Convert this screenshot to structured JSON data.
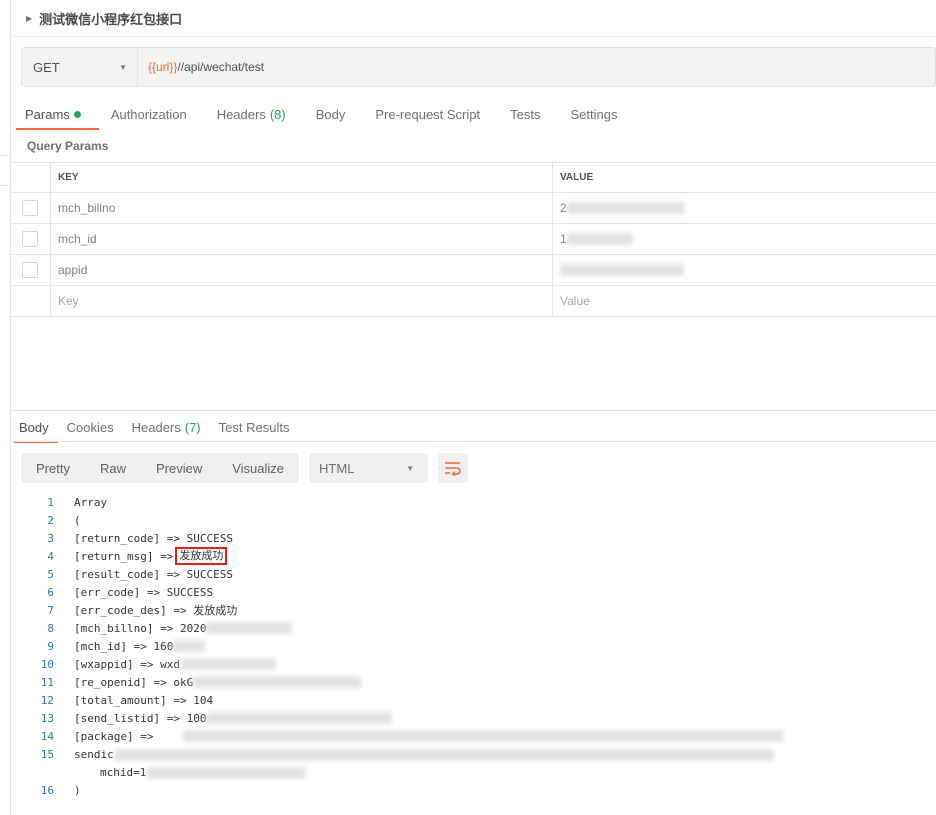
{
  "request": {
    "title": "测试微信小程序红包接口",
    "method": "GET",
    "url_variable": "{{url}}",
    "url_path": "//api/wechat/test"
  },
  "request_tabs": [
    {
      "label": "Params",
      "dot": true
    },
    {
      "label": "Authorization"
    },
    {
      "label": "Headers",
      "count": "(8)"
    },
    {
      "label": "Body"
    },
    {
      "label": "Pre-request Script"
    },
    {
      "label": "Tests"
    },
    {
      "label": "Settings"
    }
  ],
  "query_params": {
    "label": "Query Params",
    "headers": {
      "key": "KEY",
      "value": "VALUE"
    },
    "rows": [
      {
        "key": "mch_billno",
        "value": "2"
      },
      {
        "key": "mch_id",
        "value": "1"
      },
      {
        "key": "appid",
        "value": ""
      }
    ],
    "placeholder": {
      "key": "Key",
      "value": "Value"
    }
  },
  "response_tabs": [
    {
      "label": "Body"
    },
    {
      "label": "Cookies"
    },
    {
      "label": "Headers",
      "count": "(7)"
    },
    {
      "label": "Test Results"
    }
  ],
  "viewer": {
    "modes": [
      "Pretty",
      "Raw",
      "Preview",
      "Visualize"
    ],
    "format": "HTML",
    "wrap_icon": "wrap-lines-icon"
  },
  "code_lines": [
    {
      "n": "1",
      "text": "Array"
    },
    {
      "n": "2",
      "text": "("
    },
    {
      "n": "3",
      "text": "[return_code] => SUCCESS"
    },
    {
      "n": "4",
      "text": "[return_msg] =>",
      "highlight": "发放成功"
    },
    {
      "n": "5",
      "text": "[result_code] => SUCCESS"
    },
    {
      "n": "6",
      "text": "[err_code] => SUCCESS"
    },
    {
      "n": "7",
      "text": "[err_code_des] => 发放成功"
    },
    {
      "n": "8",
      "text": "[mch_billno] => 2020"
    },
    {
      "n": "9",
      "text": "[mch_id] => 160"
    },
    {
      "n": "10",
      "text": "[wxappid] => wxd"
    },
    {
      "n": "11",
      "text": "[re_openid] => okG"
    },
    {
      "n": "12",
      "text": "[total_amount] => 104"
    },
    {
      "n": "13",
      "text": "[send_listid] => 100"
    },
    {
      "n": "14",
      "text": "[package] =>"
    },
    {
      "n": "15",
      "text": "sendic",
      "subtext": "mchid=1"
    },
    {
      "n": "16",
      "text": ")"
    }
  ],
  "colors": {
    "accent": "#f26b3a",
    "green": "#26a65b",
    "highlight_border": "#e0201b"
  }
}
